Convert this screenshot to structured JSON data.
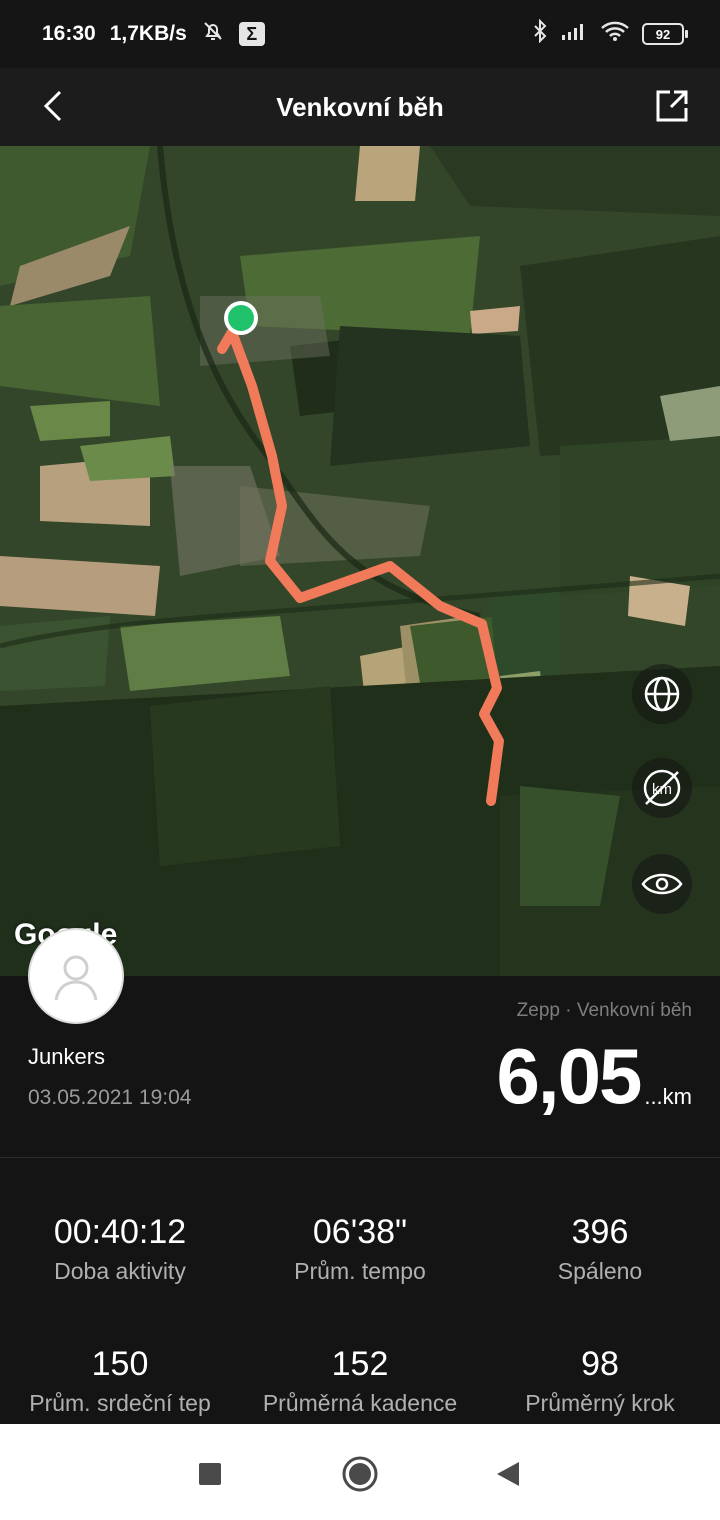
{
  "status_bar": {
    "time": "16:30",
    "speed": "1,7KB/s",
    "battery": "92",
    "icons": [
      "bell-off-icon",
      "sigma-icon",
      "bluetooth-icon",
      "signal-icon",
      "wifi-icon",
      "battery-icon"
    ]
  },
  "header": {
    "title": "Venkovní běh",
    "back_icon": "chevron-left-icon",
    "share_icon": "share-icon"
  },
  "map": {
    "attribution": "Google",
    "route_color": "#f07a5a",
    "start_marker_color": "#1fc16b",
    "controls": [
      "globe-icon",
      "km-off-icon",
      "eye-icon"
    ]
  },
  "profile": {
    "name": "Junkers",
    "datetime": "03.05.2021 19:04"
  },
  "workout": {
    "source": "Zepp · Venkovní běh",
    "distance": "6,05",
    "distance_unit": "...km"
  },
  "stats": [
    {
      "value": "00:40:12",
      "label": "Doba aktivity"
    },
    {
      "value": "06'38\"",
      "label": "Prům. tempo"
    },
    {
      "value": "396",
      "label": "Spáleno"
    },
    {
      "value": "150",
      "label": "Prům. srdeční tep"
    },
    {
      "value": "152",
      "label": "Průměrná kadence"
    },
    {
      "value": "98",
      "label": "Průměrný krok"
    }
  ],
  "nav_bar": [
    "recents-square-icon",
    "home-circle-icon",
    "back-triangle-icon"
  ]
}
